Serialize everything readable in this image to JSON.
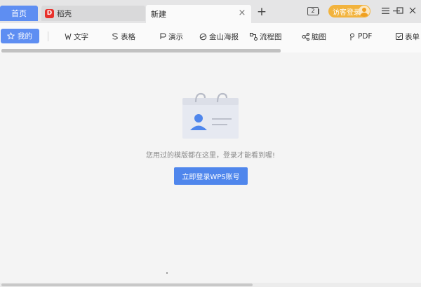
{
  "tabs": {
    "home": "首页",
    "doc": {
      "logo": "D",
      "label": "稻壳"
    },
    "new": {
      "label": "新建",
      "close": "×"
    },
    "add": "+"
  },
  "window": {
    "badge_text": "2",
    "login_label": "访客登录"
  },
  "categories": {
    "mine": "我的",
    "items": [
      "文字",
      "表格",
      "演示",
      "金山海报",
      "流程图",
      "脑图",
      "PDF",
      "表单"
    ]
  },
  "empty_state": {
    "message": "您用过的模版都在这里，登录才能看到喔!",
    "button": "立即登录WPS账号"
  },
  "colors": {
    "accent": "#5e8ef2",
    "button": "#4f86ec",
    "login_pill": "#f2b33d"
  }
}
